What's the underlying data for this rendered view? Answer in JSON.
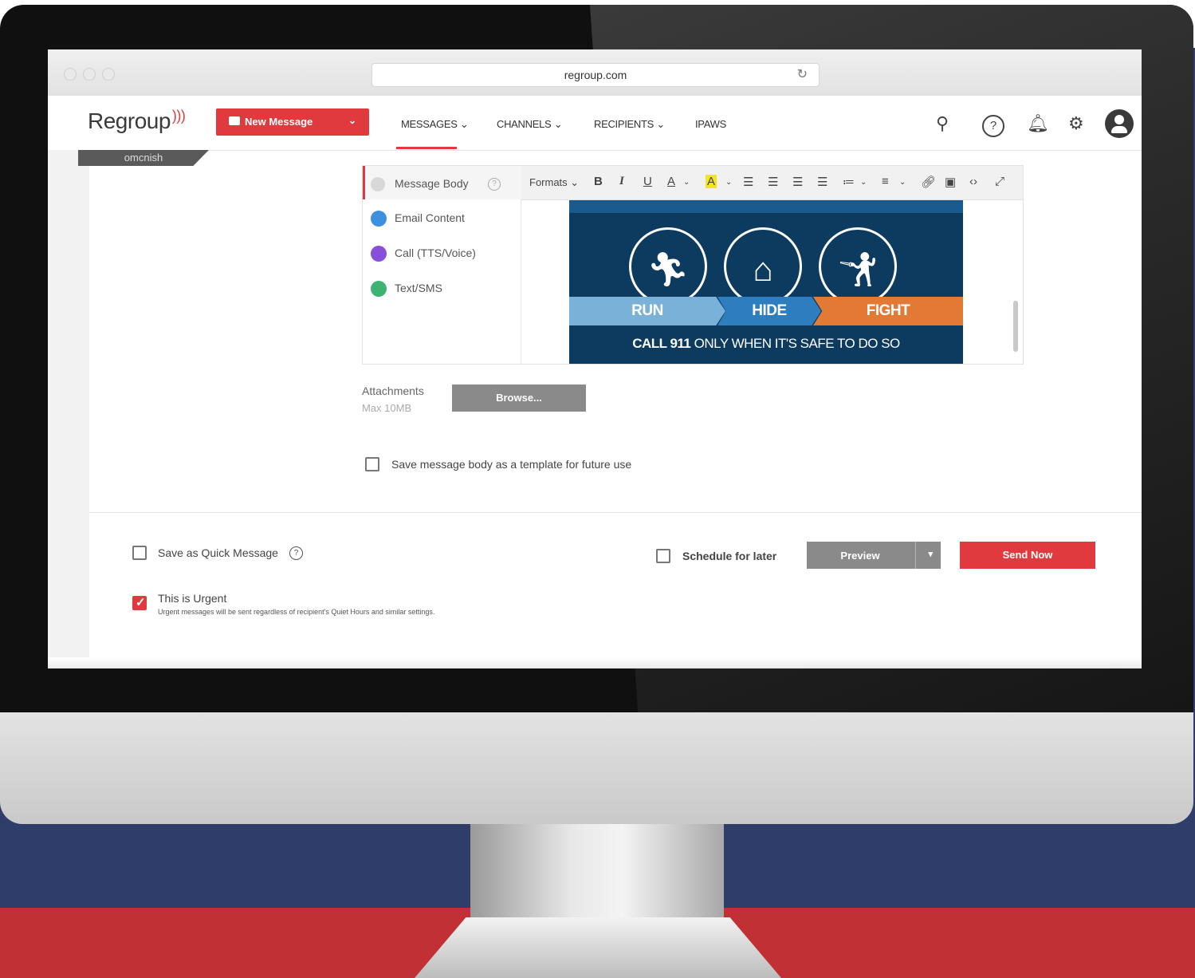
{
  "browser": {
    "url": "regroup.com",
    "reload_icon": "reload-icon"
  },
  "app": {
    "logo": "Regroup",
    "new_message": {
      "label": "New Message"
    },
    "nav": [
      {
        "label": "MESSAGES ⌄"
      },
      {
        "label": "CHANNELS ⌄"
      },
      {
        "label": "RECIPIENTS ⌄"
      },
      {
        "label": "IPAWS"
      }
    ],
    "header_icons": [
      "search-icon",
      "help-icon",
      "bell-icon",
      "gear-icon",
      "user-avatar-icon"
    ],
    "username": "omcnish"
  },
  "editor": {
    "channels": [
      {
        "label": "Message Body",
        "color": "#8a8a8a"
      },
      {
        "label": "Email Content",
        "color": "#3d8fe0"
      },
      {
        "label": "Call (TTS/Voice)",
        "color": "#8a4fd8"
      },
      {
        "label": "Text/SMS",
        "color": "#3cb371"
      }
    ],
    "toolbar": {
      "formats": "Formats"
    },
    "banner": {
      "run": "RUN",
      "hide": "HIDE",
      "fight": "FIGHT",
      "call_bold": "CALL 911",
      "call_rest": "ONLY WHEN IT'S SAFE TO DO SO"
    }
  },
  "attachments": {
    "label": "Attachments",
    "max": "Max 10MB",
    "browse": "Browse..."
  },
  "template_option": {
    "label": "Save message body as a template for future use",
    "checked": false
  },
  "quick_message": {
    "label": "Save as Quick Message",
    "checked": false
  },
  "urgent": {
    "label": "This is Urgent",
    "note": "Urgent messages will be sent regardless of recipient's Quiet Hours and similar settings.",
    "checked": true
  },
  "schedule": {
    "label": "Schedule for later",
    "checked": false
  },
  "actions": {
    "preview": "Preview",
    "send": "Send Now"
  },
  "colors": {
    "accent": "#e0393e",
    "banner_navy": "#0d3a5f",
    "run_blue": "#7ab1d8",
    "hide_blue": "#2e7dbf",
    "fight_orange": "#e27a36"
  }
}
